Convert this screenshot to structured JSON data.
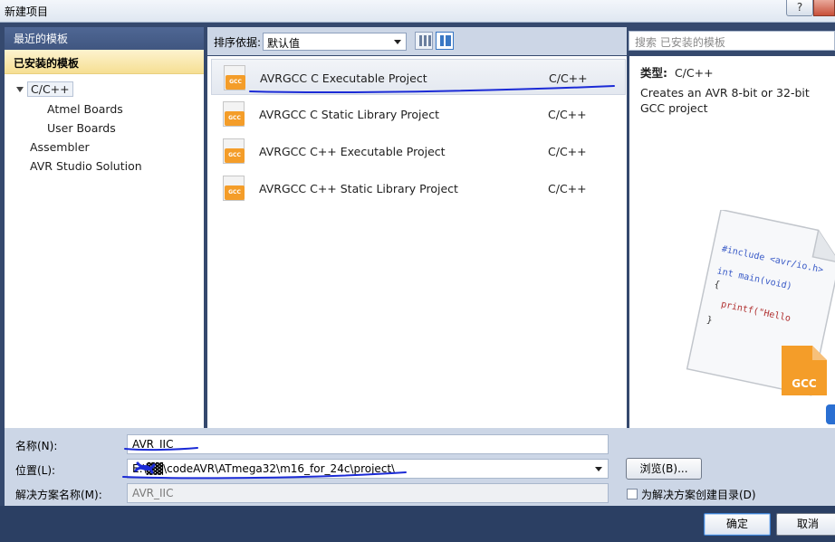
{
  "window": {
    "title": "新建项目",
    "help_label": "?"
  },
  "left": {
    "recent_label": "最近的模板",
    "installed_label": "已安装的模板",
    "tree": [
      "C/C++",
      "Atmel Boards",
      "User Boards",
      "Assembler",
      "AVR Studio Solution"
    ]
  },
  "toolbar": {
    "sort_label": "排序依据:",
    "sort_value": "默认值"
  },
  "search": {
    "placeholder": "搜索 已安装的模板"
  },
  "templates": [
    {
      "name": "AVRGCC C Executable Project",
      "lang": "C/C++",
      "selected": true
    },
    {
      "name": "AVRGCC C Static Library Project",
      "lang": "C/C++",
      "selected": false
    },
    {
      "name": "AVRGCC C++ Executable Project",
      "lang": "C/C++",
      "selected": false
    },
    {
      "name": "AVRGCC C++ Static Library Project",
      "lang": "C/C++",
      "selected": false
    }
  ],
  "icon_badge": "GCC",
  "info": {
    "type_label": "类型:",
    "type_value": "C/C++",
    "description": "Creates an AVR 8-bit or 32-bit GCC project",
    "code_lines": [
      "#include <avr/io.h>",
      "int main(void)",
      "{",
      "printf(\"Hello",
      "}"
    ],
    "badge": "GCC"
  },
  "form": {
    "name_label": "名称(N):",
    "name_value": "AVR_IIC",
    "location_label": "位置(L):",
    "location_value": "E:\\▓▓\\codeAVR\\ATmega32\\m16_for_24c\\project\\",
    "solution_label": "解决方案名称(M):",
    "solution_value": "AVR_IIC",
    "browse_label": "浏览(B)...",
    "create_dir_label": "为解决方案创建目录(D)"
  },
  "buttons": {
    "ok": "确定",
    "cancel": "取消"
  },
  "colors": {
    "accent": "#3c7fd0",
    "gcc_orange": "#f49d29",
    "ink": "#1b2bd6"
  }
}
